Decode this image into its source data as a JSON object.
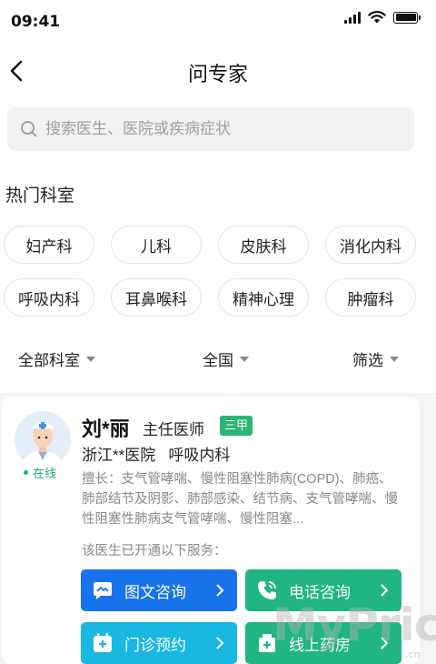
{
  "status_bar": {
    "time": "09:41"
  },
  "nav": {
    "title": "问专家"
  },
  "search": {
    "placeholder": "搜索医生、医院或疾病症状"
  },
  "hot_departments": {
    "title": "热门科室",
    "items": [
      "妇产科",
      "儿科",
      "皮肤科",
      "消化内科",
      "呼吸内科",
      "耳鼻喉科",
      "精神心理",
      "肿瘤科"
    ]
  },
  "filters": {
    "department": "全部科室",
    "region": "全国",
    "filter": "筛选"
  },
  "doctor": {
    "name": "刘*丽",
    "title": "主任医师",
    "grade": "三甲",
    "hospital": "浙江**医院   呼吸内科",
    "status": "在线",
    "specialty": "擅长：支气管哮喘、慢性阻塞性肺病(COPD)、肺癌、肺部结节及阴影、肺部感染、结节病、支气管哮喘、慢性阻塞性肺病支气管哮喘、慢性阻塞...",
    "services_caption": "该医生已开通以下服务：",
    "services": [
      "图文咨询",
      "电话咨询",
      "门诊预约",
      "线上药房"
    ]
  },
  "watermark": {
    "main": "MyPrice",
    "sub": ".cn"
  },
  "colors": {
    "blue": "#1773ea",
    "green": "#20b583",
    "cyan": "#19b7e1",
    "online": "#21b07d"
  }
}
